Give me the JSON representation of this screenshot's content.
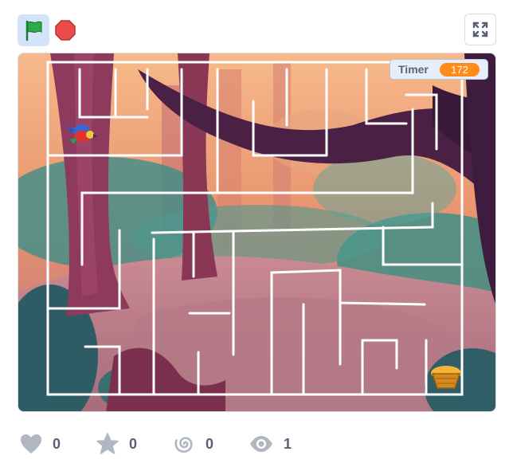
{
  "toolbar": {
    "green_flag_icon": "green-flag-icon",
    "stop_icon": "stop-sign-icon",
    "fullscreen_icon": "fullscreen-icon"
  },
  "stage": {
    "timer_label": "Timer",
    "timer_value": "172",
    "sprites": [
      "parrot",
      "basket"
    ]
  },
  "stats": {
    "loves": "0",
    "favorites": "0",
    "remixes": "0",
    "views": "1"
  },
  "colors": {
    "flag_bg": "#d3e4f8",
    "flag_green": "#2ea94b",
    "stop_red": "#ec4b4b",
    "timer_orange": "#ff8c1a",
    "maze_wall": "#ffffff",
    "stat_gray": "#575e75"
  }
}
